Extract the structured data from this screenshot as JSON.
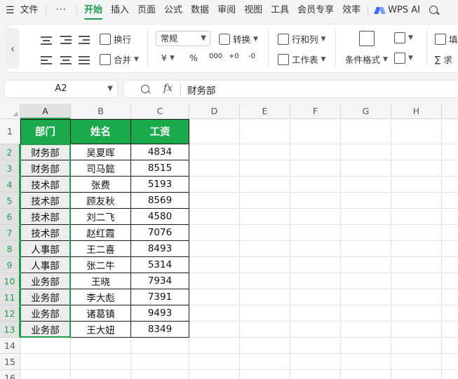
{
  "menu": {
    "items": [
      "文件",
      "开始",
      "插入",
      "页面",
      "公式",
      "数据",
      "审阅",
      "视图",
      "工具",
      "会员专享",
      "效率"
    ],
    "active": "开始",
    "more": "···",
    "wps_ai": "WPS AI"
  },
  "ribbon": {
    "wrap": "换行",
    "merge": "合并",
    "format_select": "常规",
    "convert": "转换",
    "rows_cols": "行和列",
    "worksheet": "工作表",
    "cond_format": "条件格式",
    "fill": "填",
    "sum": "求",
    "currency": "¥",
    "percent": "%",
    "thousands": "000",
    "dec_inc": "+0",
    "dec_dec": "-0"
  },
  "formula_bar": {
    "name_box": "A2",
    "fx": "fx",
    "value": "财务部"
  },
  "sheet": {
    "columns": [
      "A",
      "B",
      "C",
      "D",
      "E",
      "F",
      "G",
      "H"
    ],
    "rows": [
      "1",
      "2",
      "3",
      "4",
      "5",
      "6",
      "7",
      "8",
      "9",
      "10",
      "11",
      "12",
      "13",
      "14",
      "15",
      "16"
    ],
    "selected_column": "A",
    "table": {
      "headers": [
        "部门",
        "姓名",
        "工资"
      ],
      "data": [
        [
          "财务部",
          "吴夏晖",
          "4834"
        ],
        [
          "财务部",
          "司马懿",
          "8515"
        ],
        [
          "技术部",
          "张费",
          "5193"
        ],
        [
          "技术部",
          "顾友秋",
          "8569"
        ],
        [
          "技术部",
          "刘二飞",
          "4580"
        ],
        [
          "技术部",
          "赵红霞",
          "7076"
        ],
        [
          "人事部",
          "王二喜",
          "8493"
        ],
        [
          "人事部",
          "张二牛",
          "5314"
        ],
        [
          "业务部",
          "王晓",
          "7934"
        ],
        [
          "业务部",
          "李大彪",
          "7391"
        ],
        [
          "业务部",
          "诸葛镇",
          "9493"
        ],
        [
          "业务部",
          "王大妞",
          "8349"
        ]
      ]
    },
    "colors": {
      "header_fill": "#1aaa4c",
      "accent": "#1f9e4a"
    }
  }
}
